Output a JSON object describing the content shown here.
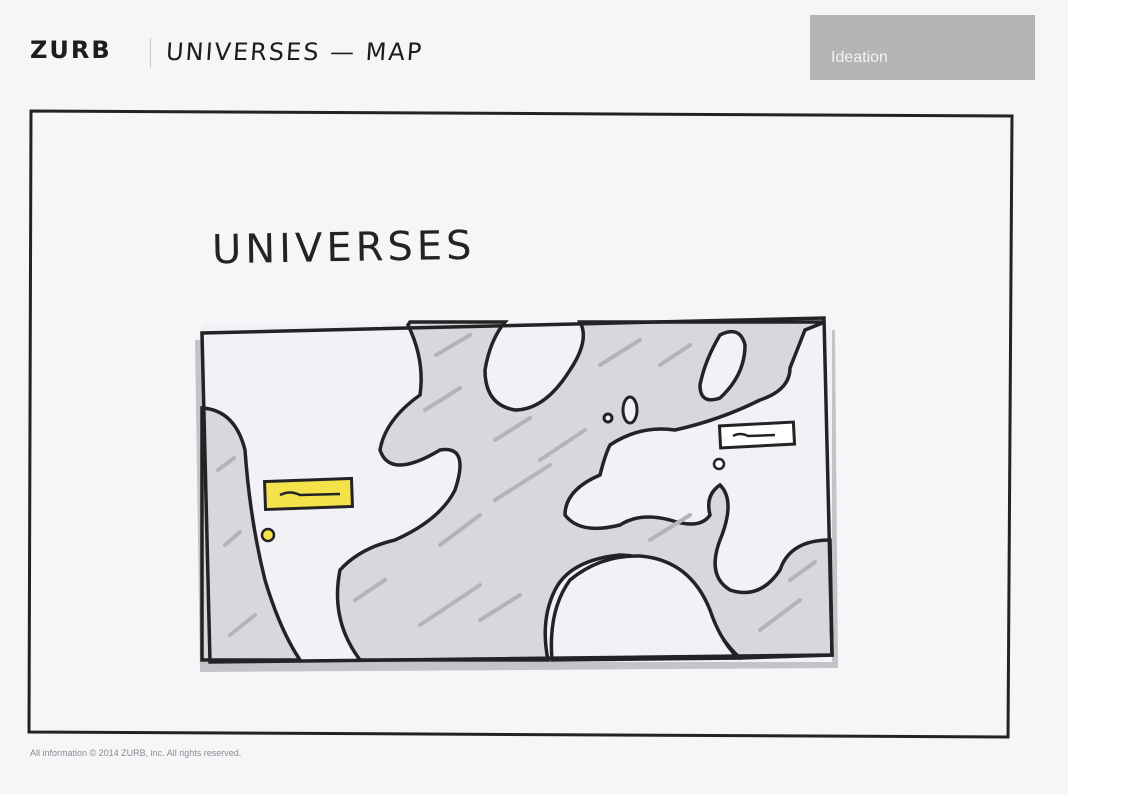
{
  "header": {
    "brand": "ZURB",
    "title": "UNIVERSES — MAP",
    "phase_badge": "Ideation"
  },
  "sketch": {
    "heading": "UNIVERSES",
    "map_markers": [
      {
        "id": "left",
        "highlighted": true,
        "color": "#f3e24a"
      },
      {
        "id": "right",
        "highlighted": false,
        "color": "#ffffff"
      }
    ]
  },
  "footer": {
    "copyright": "All information © 2014 ZURB, inc.  All rights reserved."
  },
  "colors": {
    "ink": "#232326",
    "shade": "#bdbdc2",
    "badge": "#b5b5b8",
    "highlight": "#f3e24a"
  }
}
